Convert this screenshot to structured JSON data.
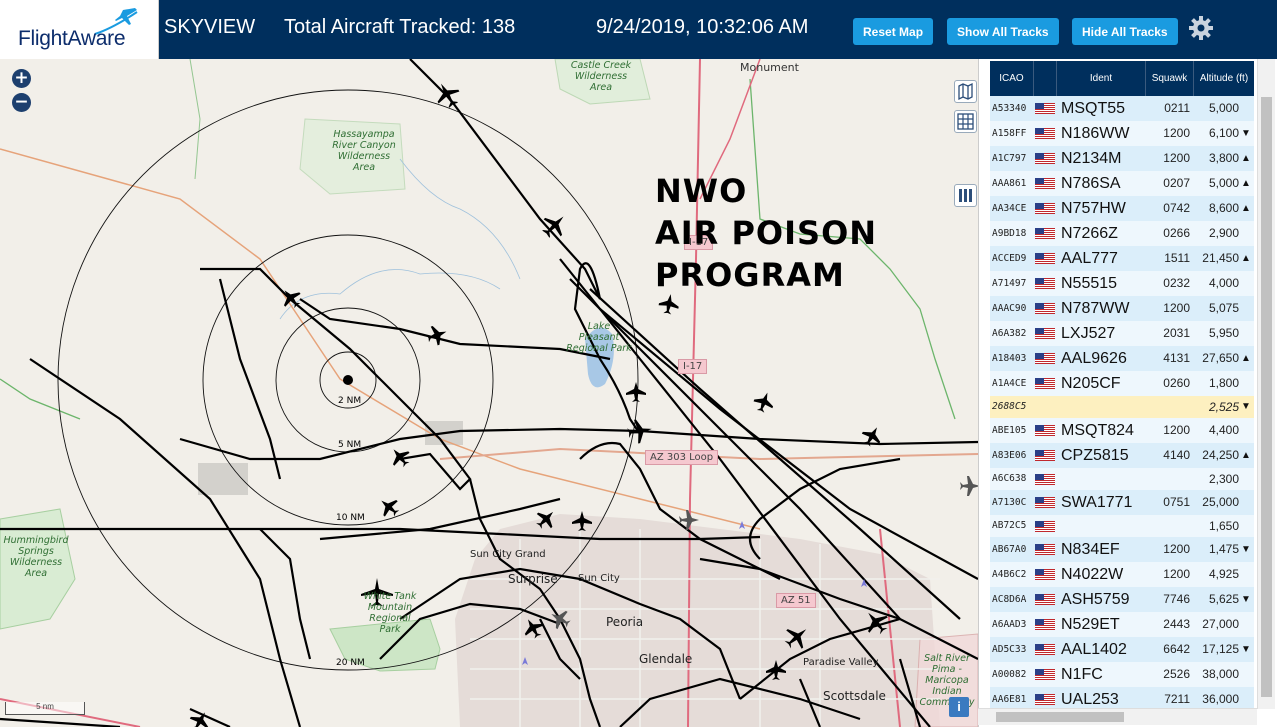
{
  "header": {
    "logo": "FlightAware",
    "app_title": "SKYVIEW",
    "tracked": "Total Aircraft Tracked: 138",
    "datetime": "9/24/2019, 10:32:06 AM",
    "buttons": {
      "reset": "Reset Map",
      "show": "Show All Tracks",
      "hide": "Hide All Tracks"
    },
    "colors": {
      "bar": "#002f5d",
      "button": "#1a9be0"
    }
  },
  "map": {
    "overlay_lines": [
      "NWO",
      "AIR POISON",
      "PROGRAM"
    ],
    "zoom_in": "+",
    "zoom_out": "−",
    "scale": "5 nm",
    "ring_labels": [
      "2 NM",
      "5 NM",
      "10 NM",
      "20 NM"
    ],
    "parks": [
      "Castle Creek Wilderness Area",
      "Hassayampa River Canyon Wilderness Area",
      "Lake Pleasant Regional Park",
      "Hummingbird Springs Wilderness Area",
      "White Tank Mountain Regional Park",
      "Salt River Pima - Maricopa Indian Community"
    ],
    "places": [
      "Monument",
      "Sun City Grand",
      "Surprise",
      "Sun City",
      "Peoria",
      "Glendale",
      "Paradise Valley",
      "Scottsdale"
    ],
    "roads": [
      "I-17",
      "I-17",
      "AZ 303 Loop",
      "AZ 51"
    ]
  },
  "table": {
    "headers": {
      "icao": "ICAO",
      "ident": "Ident",
      "squawk": "Squawk",
      "altitude": "Altitude (ft)"
    },
    "rows": [
      {
        "icao": "A53340",
        "ident": "MSQT55",
        "squawk": "0211",
        "alt": "5,000",
        "arrow": ""
      },
      {
        "icao": "A158FF",
        "ident": "N186WW",
        "squawk": "1200",
        "alt": "6,100",
        "arrow": "▼"
      },
      {
        "icao": "A1C797",
        "ident": "N2134M",
        "squawk": "1200",
        "alt": "3,800",
        "arrow": "▲"
      },
      {
        "icao": "AAA861",
        "ident": "N786SA",
        "squawk": "0207",
        "alt": "5,000",
        "arrow": "▲"
      },
      {
        "icao": "AA34CE",
        "ident": "N757HW",
        "squawk": "0742",
        "alt": "8,600",
        "arrow": "▲"
      },
      {
        "icao": "A9BD18",
        "ident": "N7266Z",
        "squawk": "0266",
        "alt": "2,900",
        "arrow": ""
      },
      {
        "icao": "ACCED9",
        "ident": "AAL777",
        "squawk": "1511",
        "alt": "21,450",
        "arrow": "▲"
      },
      {
        "icao": "A71497",
        "ident": "N55515",
        "squawk": "0232",
        "alt": "4,000",
        "arrow": ""
      },
      {
        "icao": "AAAC90",
        "ident": "N787WW",
        "squawk": "1200",
        "alt": "5,075",
        "arrow": ""
      },
      {
        "icao": "A6A382",
        "ident": "LXJ527",
        "squawk": "2031",
        "alt": "5,950",
        "arrow": ""
      },
      {
        "icao": "A18403",
        "ident": "AAL9626",
        "squawk": "4131",
        "alt": "27,650",
        "arrow": "▲"
      },
      {
        "icao": "A1A4CE",
        "ident": "N205CF",
        "squawk": "0260",
        "alt": "1,800",
        "arrow": ""
      },
      {
        "icao": "2688C5",
        "ident": "",
        "squawk": "",
        "alt": "2,525",
        "arrow": "▼",
        "flag": false,
        "selected": true
      },
      {
        "icao": "ABE105",
        "ident": "MSQT824",
        "squawk": "1200",
        "alt": "4,400",
        "arrow": ""
      },
      {
        "icao": "A83E06",
        "ident": "CPZ5815",
        "squawk": "4140",
        "alt": "24,250",
        "arrow": "▲"
      },
      {
        "icao": "A6C638",
        "ident": "",
        "squawk": "",
        "alt": "2,300",
        "arrow": ""
      },
      {
        "icao": "A7130C",
        "ident": "SWA1771",
        "squawk": "0751",
        "alt": "25,000",
        "arrow": ""
      },
      {
        "icao": "AB72C5",
        "ident": "",
        "squawk": "",
        "alt": "1,650",
        "arrow": ""
      },
      {
        "icao": "AB67A0",
        "ident": "N834EF",
        "squawk": "1200",
        "alt": "1,475",
        "arrow": "▼"
      },
      {
        "icao": "A4B6C2",
        "ident": "N4022W",
        "squawk": "1200",
        "alt": "4,925",
        "arrow": ""
      },
      {
        "icao": "AC8D6A",
        "ident": "ASH5759",
        "squawk": "7746",
        "alt": "5,625",
        "arrow": "▼"
      },
      {
        "icao": "A6AAD3",
        "ident": "N529ET",
        "squawk": "2443",
        "alt": "27,000",
        "arrow": ""
      },
      {
        "icao": "AD5C33",
        "ident": "AAL1402",
        "squawk": "6642",
        "alt": "17,125",
        "arrow": "▼"
      },
      {
        "icao": "A00082",
        "ident": "N1FC",
        "squawk": "2526",
        "alt": "38,000",
        "arrow": ""
      },
      {
        "icao": "AA6E81",
        "ident": "UAL253",
        "squawk": "7211",
        "alt": "36,000",
        "arrow": ""
      }
    ]
  }
}
